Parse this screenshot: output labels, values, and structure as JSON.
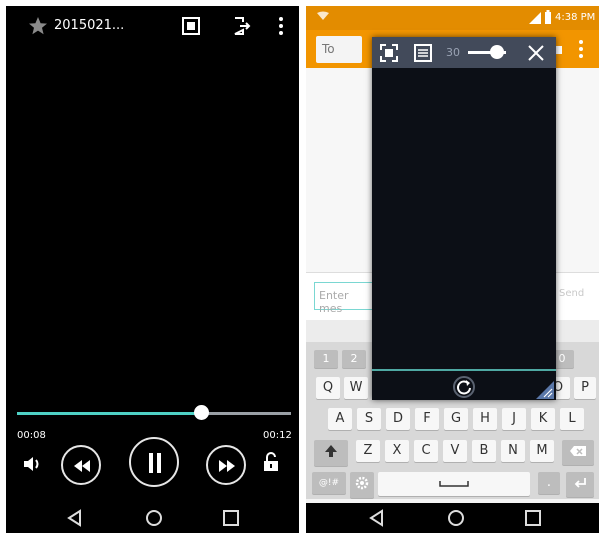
{
  "left_player": {
    "title": "2015021...",
    "time_elapsed": "00:08",
    "time_total": "00:12",
    "progress_fraction": 0.67,
    "icons": {
      "favorite": "star-icon",
      "qslide": "popup-window-icon",
      "exit": "exit-icon",
      "more": "more-vertical-icon",
      "volume": "volume-icon",
      "rewind": "rewind-icon",
      "pause": "pause-icon",
      "fast_forward": "fast-forward-icon",
      "lock": "unlock-icon",
      "back": "back-nav-icon",
      "home": "home-nav-icon",
      "recents": "recents-nav-icon"
    }
  },
  "right_messaging": {
    "status_time": "4:38 PM",
    "to_placeholder": "To",
    "compose_placeholder": "Enter mes",
    "send_label": "Send",
    "popup": {
      "zoom_level": "30",
      "slider_fraction": 0.55
    },
    "keyboard": {
      "numbers_left": [
        "1",
        "2"
      ],
      "numbers_right": [
        "0"
      ],
      "row1_left": [
        "Q",
        "W"
      ],
      "row1_right": [
        "O",
        "P"
      ],
      "row2": [
        "A",
        "S",
        "D",
        "F",
        "G",
        "H",
        "J",
        "K",
        "L"
      ],
      "row3": [
        "Z",
        "X",
        "C",
        "V",
        "B",
        "N",
        "M"
      ],
      "symbols_key": "@!#",
      "period_key": "."
    }
  },
  "colors": {
    "accent_teal": "#4fd1c5",
    "messaging_orange": "#f29500",
    "status_orange": "#e38c00"
  }
}
